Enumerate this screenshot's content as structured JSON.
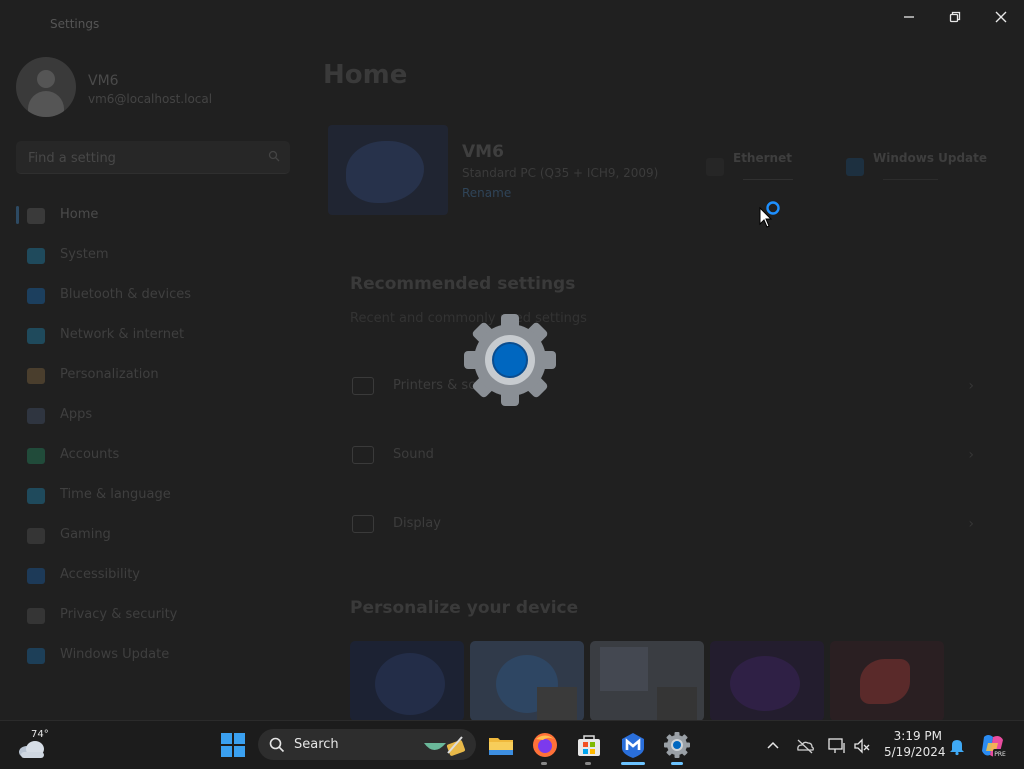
{
  "window": {
    "app_title": "Settings",
    "controls": [
      "minimize-icon",
      "restore-icon",
      "close-icon"
    ]
  },
  "profile": {
    "name": "VM6",
    "email": "vm6@localhost.local"
  },
  "search": {
    "placeholder": "Find a setting"
  },
  "sidebar": {
    "items": [
      {
        "label": "Home",
        "icon": "home-icon",
        "color": "#3a3a3a",
        "active": true
      },
      {
        "label": "System",
        "icon": "system-icon",
        "color": "#1f4a5c"
      },
      {
        "label": "Bluetooth & devices",
        "icon": "bluetooth-icon",
        "color": "#1c3f5e"
      },
      {
        "label": "Network & internet",
        "icon": "network-icon",
        "color": "#1f4a5c"
      },
      {
        "label": "Personalization",
        "icon": "brush-icon",
        "color": "#4a3e2d"
      },
      {
        "label": "Apps",
        "icon": "apps-icon",
        "color": "#2f3540"
      },
      {
        "label": "Accounts",
        "icon": "accounts-icon",
        "color": "#214b3a"
      },
      {
        "label": "Time & language",
        "icon": "globe-icon",
        "color": "#1f4a5c"
      },
      {
        "label": "Gaming",
        "icon": "gaming-icon",
        "color": "#353535"
      },
      {
        "label": "Accessibility",
        "icon": "accessibility-icon",
        "color": "#1d3a58"
      },
      {
        "label": "Privacy & security",
        "icon": "shield-icon",
        "color": "#353535"
      },
      {
        "label": "Windows Update",
        "icon": "update-icon",
        "color": "#1d3f58"
      }
    ]
  },
  "main": {
    "title": "Home",
    "device": {
      "name": "VM6",
      "spec": "Standard PC (Q35 + ICH9, 2009)",
      "rename": "Rename"
    },
    "status_tiles": [
      {
        "label": "Ethernet",
        "sub": "",
        "icon": "ethernet-icon"
      },
      {
        "label": "Windows Update",
        "sub": "",
        "icon": "update-icon"
      }
    ],
    "recommended": {
      "title": "Recommended settings",
      "subtitle": "Recent and commonly used settings",
      "items": [
        {
          "label": "Printers & scanners",
          "icon": "printer-icon"
        },
        {
          "label": "Sound",
          "icon": "sound-icon"
        },
        {
          "label": "Display",
          "icon": "display-icon"
        }
      ]
    },
    "personalize": {
      "title": "Personalize your device"
    }
  },
  "taskbar": {
    "weather_temp": "74°",
    "search_label": "Search",
    "pinned": [
      "start-icon",
      "file-explorer-icon",
      "firefox-icon",
      "store-icon",
      "malwarebytes-icon",
      "settings-icon"
    ],
    "time": "3:19 PM",
    "date": "5/19/2024"
  },
  "colors": {
    "accent": "#0067c0",
    "gear": "#8a8f95",
    "taskbar": "#1c1c1c",
    "window": "#202020"
  }
}
